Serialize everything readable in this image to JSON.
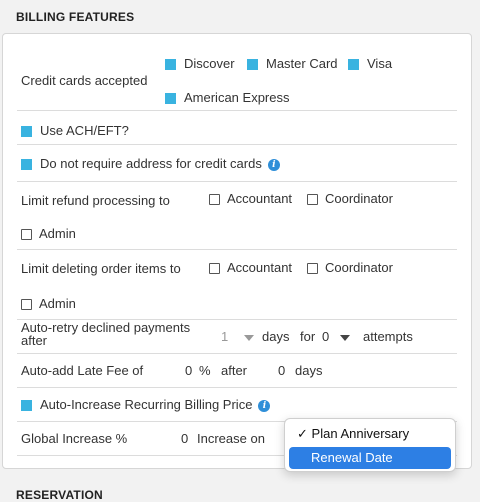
{
  "billing": {
    "title": "BILLING FEATURES",
    "credit_cards": {
      "label": "Credit cards accepted",
      "options": [
        "Discover",
        "Master Card",
        "Visa",
        "American Express"
      ]
    },
    "ach_label": "Use ACH/EFT?",
    "no_address_label": "Do not require address for credit cards",
    "refund": {
      "label": "Limit refund processing to",
      "options": [
        "Accountant",
        "Coordinator",
        "Admin"
      ]
    },
    "delete_items": {
      "label": "Limit deleting order items to",
      "options": [
        "Accountant",
        "Coordinator",
        "Admin"
      ]
    },
    "auto_retry": {
      "label": "Auto-retry declined payments after",
      "days_value": "1",
      "days_label": "days",
      "for_label": "for",
      "attempts_value": "0",
      "attempts_label": "attempts"
    },
    "late_fee": {
      "label": "Auto-add Late Fee of",
      "value": "0",
      "unit": "%",
      "after_label": "after",
      "days_value": "0",
      "days_label": "days"
    },
    "auto_increase_label": "Auto-Increase Recurring Billing Price",
    "global_increase": {
      "label": "Global Increase %",
      "value": "0",
      "increase_on_label": "Increase on"
    }
  },
  "dropdown": {
    "options": [
      "Plan Anniversary",
      "Renewal Date"
    ],
    "checkmark": "✓",
    "checked_option": "Plan Anniversary",
    "highlighted_option": "Renewal Date"
  },
  "reservation": {
    "title": "RESERVATION"
  },
  "colors": {
    "checkbox_fill": "#39b3e0",
    "info_icon": "#2f8fd8",
    "dropdown_highlight": "#2d7fe4"
  }
}
